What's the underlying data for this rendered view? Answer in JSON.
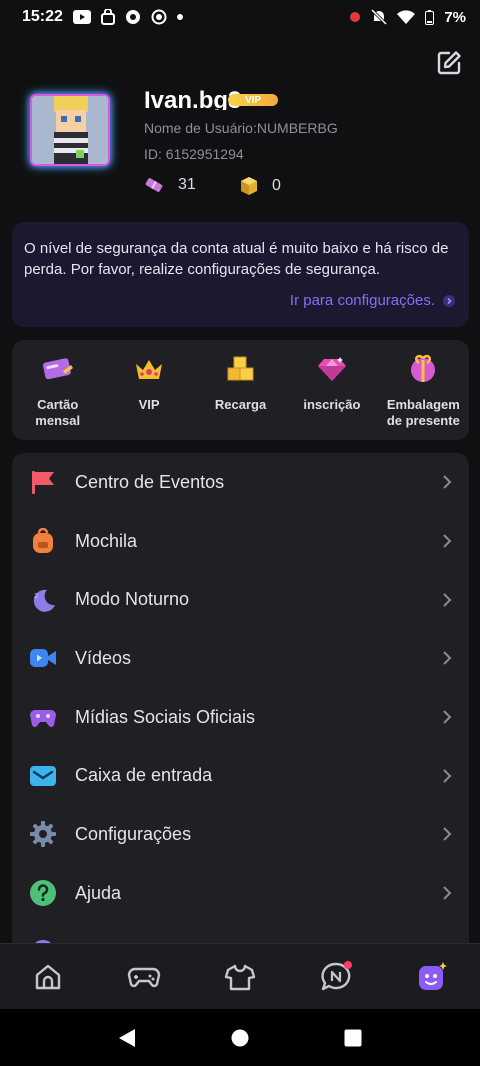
{
  "status_bar": {
    "time": "15:22",
    "battery": "7%"
  },
  "profile": {
    "username": "Ivan.bg3",
    "vip_badge": "VIP",
    "user_line": "Nome de Usuário:NUMBERBG",
    "id_line": "ID: 6152951294",
    "tickets": "31",
    "coins": "0"
  },
  "security": {
    "message": "O nível de segurança da conta atual é muito baixo e há risco de perda. Por favor, realize configurações de segurança.",
    "link": "Ir para configurações."
  },
  "quick_actions": [
    {
      "label": "Cartão mensal",
      "icon": "card-icon"
    },
    {
      "label": "VIP",
      "icon": "crown-icon"
    },
    {
      "label": "Recarga",
      "icon": "gold-blocks-icon"
    },
    {
      "label": "inscrição",
      "icon": "gem-icon"
    },
    {
      "label": "Embalagem de presente",
      "icon": "gift-icon"
    }
  ],
  "menu": [
    {
      "label": "Centro de Eventos",
      "icon": "flag-icon"
    },
    {
      "label": "Mochila",
      "icon": "backpack-icon"
    },
    {
      "label": "Modo Noturno",
      "icon": "moon-icon"
    },
    {
      "label": "Vídeos",
      "icon": "video-icon"
    },
    {
      "label": "Mídias Sociais Oficiais",
      "icon": "gamepad-social-icon"
    },
    {
      "label": "Caixa de entrada",
      "icon": "mail-icon"
    },
    {
      "label": "Configurações",
      "icon": "gear-icon"
    },
    {
      "label": "Ajuda",
      "icon": "help-icon"
    }
  ],
  "colors": {
    "accent": "#8b6cf6",
    "background": "#101013",
    "card": "#1f1f24",
    "banner": "#1a1930",
    "notification_dot": "#ff3b6b"
  }
}
